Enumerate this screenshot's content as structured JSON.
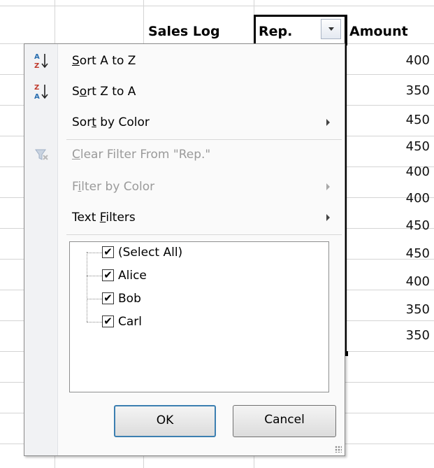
{
  "sheet": {
    "headers": {
      "title": "Sales Log",
      "rep": "Rep.",
      "amount": "Amount"
    },
    "amounts": [
      "400",
      "350",
      "450",
      "450",
      "400",
      "400",
      "450",
      "450",
      "400",
      "350",
      "350"
    ]
  },
  "menu": {
    "items": [
      {
        "label": "Sort A to Z",
        "icon": "sort-ascending-icon",
        "enabled": true
      },
      {
        "label": "Sort Z to A",
        "icon": "sort-descending-icon",
        "enabled": true
      },
      {
        "label": "Sort by Color",
        "enabled": true,
        "submenu": true
      },
      {
        "label": "Clear Filter From \"Rep.\"",
        "icon": "clear-filter-icon",
        "enabled": false
      },
      {
        "label": "Filter by Color",
        "enabled": false,
        "submenu": true
      },
      {
        "label": "Text Filters",
        "enabled": true,
        "submenu": true
      }
    ],
    "filter_list": [
      {
        "label": "(Select All)",
        "checked": true
      },
      {
        "label": "Alice",
        "checked": true
      },
      {
        "label": "Bob",
        "checked": true
      },
      {
        "label": "Carl",
        "checked": true
      }
    ],
    "ok_label": "OK",
    "cancel_label": "Cancel"
  }
}
